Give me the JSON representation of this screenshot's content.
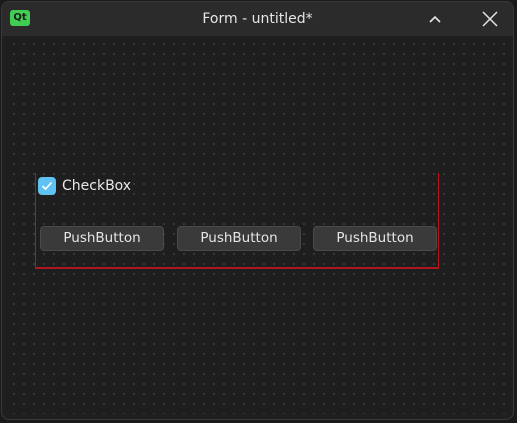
{
  "window": {
    "title": "Form - untitled*",
    "app_logo_text": "Qt"
  },
  "form": {
    "checkbox": {
      "label": "CheckBox",
      "checked": true
    },
    "buttons": [
      {
        "label": "PushButton"
      },
      {
        "label": "PushButton"
      },
      {
        "label": "PushButton"
      }
    ]
  },
  "colors": {
    "qt_brand": "#41cd52",
    "checkbox_accent": "#5fc2f2",
    "layout_outline": "#b0161d"
  },
  "icons": {
    "collapse": "chevron-up-icon",
    "close": "close-icon",
    "check": "checkmark-icon"
  }
}
